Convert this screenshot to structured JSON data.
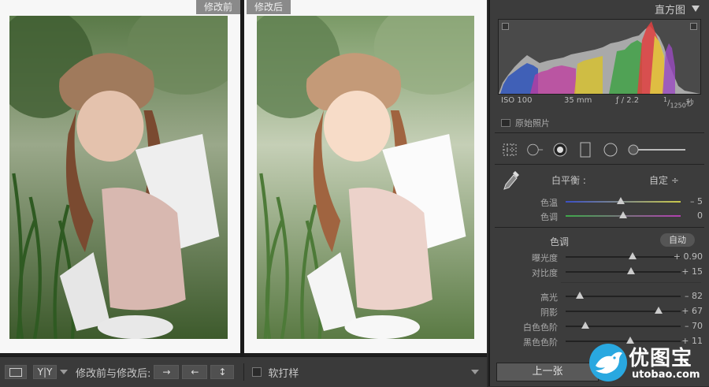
{
  "compare": {
    "before_label": "修改前",
    "after_label": "修改后"
  },
  "toolbar": {
    "view_mode_label": "Y|Y",
    "compare_label": "修改前与修改后:",
    "copy_right_label": "→",
    "copy_left_label": "←",
    "swap_label": "↕",
    "soft_proof_label": "软打样"
  },
  "histogram": {
    "title": "直方图",
    "iso": "ISO 100",
    "focal": "35 mm",
    "aperture": "ƒ / 2.2",
    "shutter_num": "1",
    "shutter_den": "1250",
    "shutter_unit": "秒",
    "original_photo_label": "原始照片"
  },
  "basic": {
    "white_balance_label": "白平衡 :",
    "white_balance_value": "自定 ÷",
    "temp_label": "色温",
    "temp_value": "– 5",
    "temp_level": 0.48,
    "tint_label": "色调",
    "tint_value": "0",
    "tint_level": 0.5,
    "tone_label": "色调",
    "auto_label": "自动",
    "exposure_label": "曝光度",
    "exposure_value": "+ 0.90",
    "exposure_level": 0.58,
    "contrast_label": "对比度",
    "contrast_value": "+ 15",
    "contrast_level": 0.57,
    "highlights_label": "高光",
    "highlights_value": "– 82",
    "highlights_level": 0.12,
    "shadows_label": "阴影",
    "shadows_value": "+ 67",
    "shadows_level": 0.81,
    "whites_label": "白色色阶",
    "whites_value": "– 70",
    "whites_level": 0.17,
    "blacks_label": "黑色色阶",
    "blacks_value": "+ 11",
    "blacks_level": 0.56
  },
  "navigation": {
    "prev_label": "上一张"
  },
  "watermark": {
    "brand": "优图宝",
    "domain": "utobao.com"
  },
  "colors": {
    "panel_bg": "#3c3c3c",
    "pane_bg": "#f7f7f7",
    "watermark_bird": "#29a8e0"
  }
}
